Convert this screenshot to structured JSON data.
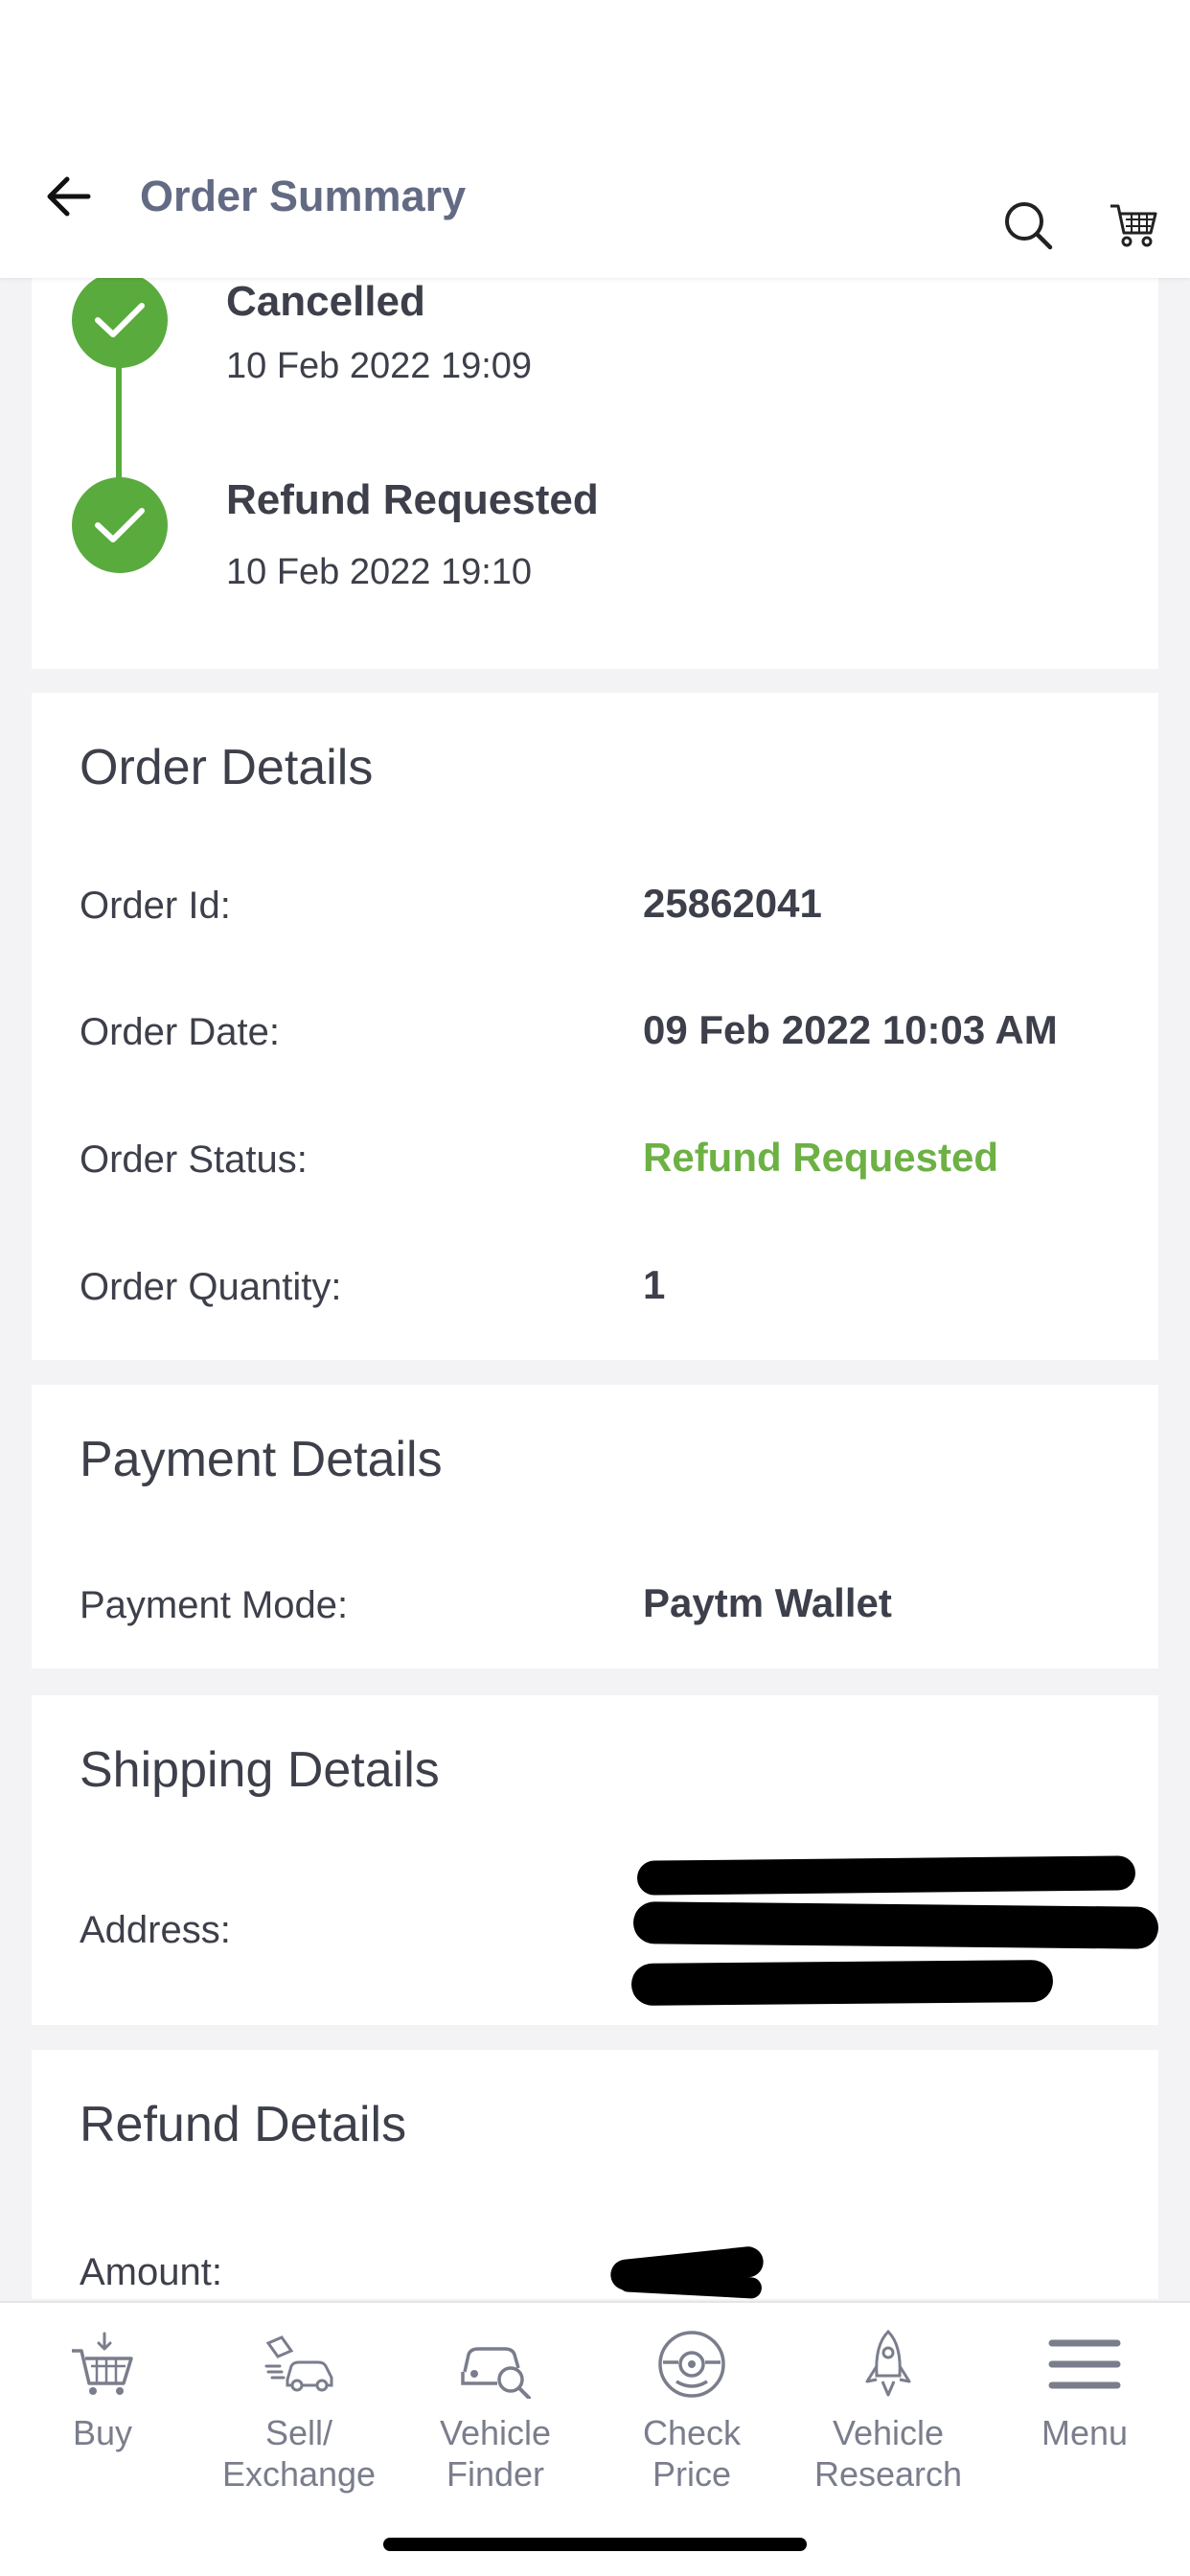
{
  "header": {
    "title": "Order Summary",
    "back_icon": "arrow-left-icon",
    "search_icon": "search-icon",
    "cart_icon": "cart-icon"
  },
  "timeline": [
    {
      "title": "Cancelled",
      "date": "10 Feb 2022 19:09"
    },
    {
      "title": "Refund Requested",
      "date": "10 Feb 2022 19:10"
    }
  ],
  "order_details": {
    "title": "Order Details",
    "rows": [
      {
        "label": "Order Id:",
        "value": "25862041"
      },
      {
        "label": "Order Date:",
        "value": "09 Feb 2022 10:03 AM"
      },
      {
        "label": "Order Status:",
        "value": "Refund Requested"
      },
      {
        "label": "Order Quantity:",
        "value": "1"
      }
    ]
  },
  "payment_details": {
    "title": "Payment Details",
    "rows": [
      {
        "label": "Payment Mode:",
        "value": "Paytm Wallet"
      }
    ]
  },
  "shipping_details": {
    "title": "Shipping Details",
    "rows": [
      {
        "label": "Address:"
      }
    ]
  },
  "refund_details": {
    "title": "Refund Details",
    "rows": [
      {
        "label": "Amount:"
      }
    ]
  },
  "bottom_nav": [
    {
      "label": "Buy",
      "icon": "cart-icon"
    },
    {
      "label": "Sell/\nExchange",
      "icon": "sell-exchange-icon"
    },
    {
      "label": "Vehicle\nFinder",
      "icon": "vehicle-finder-icon"
    },
    {
      "label": "Check\nPrice",
      "icon": "check-price-icon"
    },
    {
      "label": "Vehicle\nResearch",
      "icon": "rocket-icon"
    },
    {
      "label": "Menu",
      "icon": "menu-icon"
    }
  ],
  "colors": {
    "accent_green": "#5aab3e",
    "status_green": "#6db145",
    "header_title": "#636b84",
    "text": "#3d3f4a",
    "nav_text": "#7a7d8c"
  }
}
